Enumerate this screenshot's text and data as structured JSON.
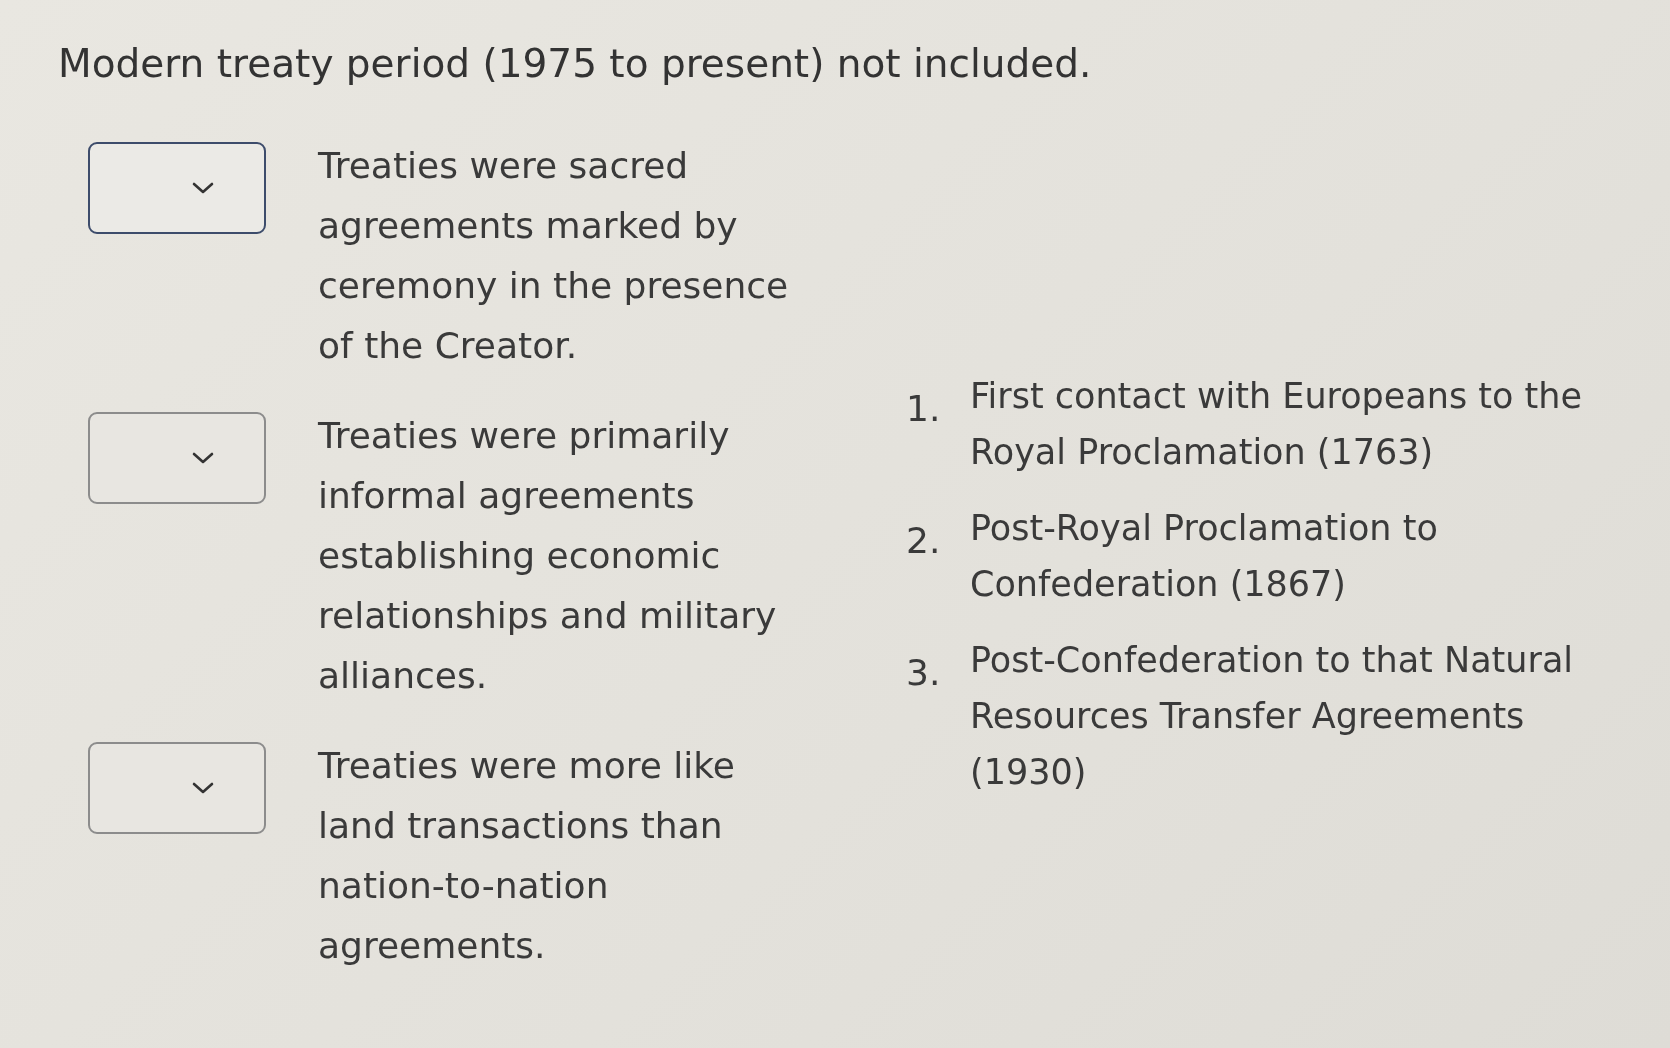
{
  "heading": "Modern treaty period (1975 to present) not included.",
  "statements": [
    {
      "text": "Treaties were sacred agreements marked by ceremony in the presence of the Creator.",
      "focused": true
    },
    {
      "text": "Treaties were primarily informal agreements establishing economic relationships and military alliances.",
      "focused": false
    },
    {
      "text": "Treaties were more like land transactions than nation-to-nation agreements.",
      "focused": false
    }
  ],
  "periods": [
    {
      "number": "1.",
      "text": "First contact with Europeans to the Royal Proclamation (1763)"
    },
    {
      "number": "2.",
      "text": "Post-Royal Proclamation to Confederation (1867)"
    },
    {
      "number": "3.",
      "text": "Post-Confederation to that Natural Resources Transfer Agreements (1930)"
    }
  ]
}
